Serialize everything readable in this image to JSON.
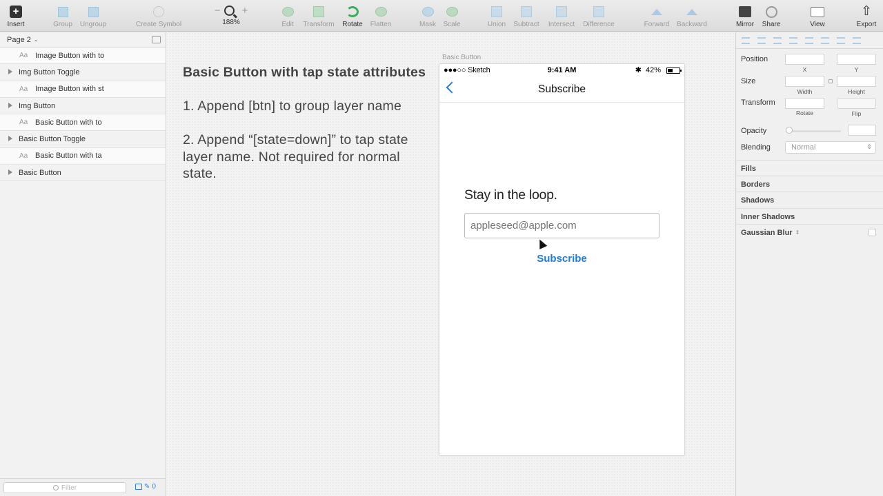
{
  "toolbar": {
    "insert": "Insert",
    "group": "Group",
    "ungroup": "Ungroup",
    "create_symbol": "Create Symbol",
    "zoom_minus": "−",
    "zoom_plus": "+",
    "zoom_level": "188%",
    "edit": "Edit",
    "transform": "Transform",
    "rotate": "Rotate",
    "flatten": "Flatten",
    "mask": "Mask",
    "scale": "Scale",
    "union": "Union",
    "subtract": "Subtract",
    "intersect": "Intersect",
    "difference": "Difference",
    "forward": "Forward",
    "backward": "Backward",
    "mirror": "Mirror",
    "share": "Share",
    "view": "View",
    "export": "Export"
  },
  "sidebar": {
    "page": "Page 2",
    "layers": [
      {
        "name": "Image Button with to"
      },
      {
        "name": "Img Button Toggle"
      },
      {
        "name": "Image Button with st"
      },
      {
        "name": "Img Button"
      },
      {
        "name": "Basic Button with to"
      },
      {
        "name": "Basic Button Toggle"
      },
      {
        "name": "Basic Button with ta"
      },
      {
        "name": "Basic Button"
      }
    ],
    "text_glyph": "Aa",
    "filter_placeholder": "Filter",
    "filter_count": "0"
  },
  "canvas": {
    "heading": "Basic Button with tap state attributes",
    "step1": "1. Append [btn] to group layer name",
    "step2": "2. Append “[state=down]” to tap state layer name. Not required for normal state.",
    "artboard_label": "Basic Button"
  },
  "phone": {
    "carrier": "●●●○○ Sketch",
    "time": "9:41 AM",
    "battery": "42%",
    "bluetooth": "✱",
    "nav_title": "Subscribe",
    "heading": "Stay in the loop.",
    "email_placeholder": "appleseed@apple.com",
    "subscribe": "Subscribe",
    "accent": "#1f7ce0"
  },
  "inspector": {
    "position": "Position",
    "x": "X",
    "y": "Y",
    "size": "Size",
    "width": "Width",
    "height": "Height",
    "transform": "Transform",
    "rotate": "Rotate",
    "flip": "Flip",
    "opacity": "Opacity",
    "blending": "Blending",
    "blending_value": "Normal",
    "fills": "Fills",
    "borders": "Borders",
    "shadows": "Shadows",
    "inner_shadows": "Inner Shadows",
    "gaussian_blur": "Gaussian Blur"
  }
}
